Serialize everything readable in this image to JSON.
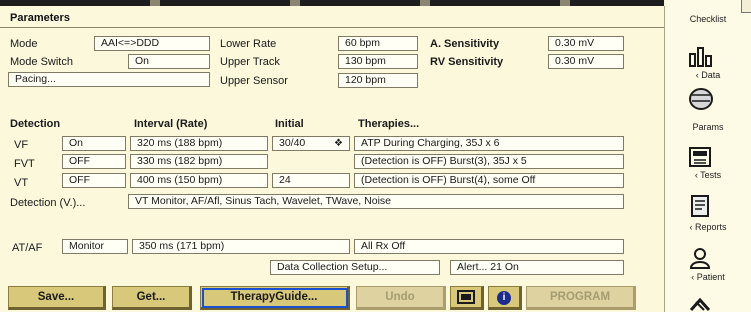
{
  "title": "Parameters",
  "params": {
    "mode_label": "Mode",
    "mode_value": "AAI<=>DDD",
    "mode_switch_label": "Mode Switch",
    "mode_switch_value": "On",
    "pacing_label": "Pacing...",
    "lower_rate_label": "Lower Rate",
    "lower_rate_value": "60 bpm",
    "upper_track_label": "Upper Track",
    "upper_track_value": "130 bpm",
    "upper_sensor_label": "Upper Sensor",
    "upper_sensor_value": "120 bpm",
    "a_sens_label": "A. Sensitivity",
    "a_sens_value": "0.30 mV",
    "rv_sens_label": "RV Sensitivity",
    "rv_sens_value": "0.30 mV"
  },
  "detection": {
    "headers": {
      "detection": "Detection",
      "interval": "Interval (Rate)",
      "initial": "Initial",
      "therapies": "Therapies..."
    },
    "rows": [
      {
        "zone": "VF",
        "status": "On",
        "interval": "320 ms (188 bpm)",
        "initial": "30/40",
        "therapy": "ATP During Charging, 35J x 6"
      },
      {
        "zone": "FVT",
        "status": "OFF",
        "interval": "330 ms (182 bpm)",
        "initial": "",
        "therapy": "(Detection is OFF)    Burst(3), 35J x 5"
      },
      {
        "zone": "VT",
        "status": "OFF",
        "interval": "400 ms (150 bpm)",
        "initial": "24",
        "therapy": "(Detection is OFF)    Burst(4), some Off"
      }
    ],
    "detection_v_label": "Detection (V.)...",
    "detection_v_value": "VT Monitor, AF/Afl, Sinus Tach, Wavelet, TWave, Noise"
  },
  "ataf": {
    "label": "AT/AF",
    "mode": "Monitor",
    "interval": "350 ms (171 bpm)",
    "therapy": "All Rx Off"
  },
  "data_collection": "Data Collection Setup...",
  "alert": "Alert... 21 On",
  "buttons": {
    "save": "Save...",
    "get": "Get...",
    "therapy_guide": "TherapyGuide...",
    "undo": "Undo",
    "info": "i",
    "program": "PROGRAM"
  },
  "sidebar": {
    "checklist": "Checklist",
    "data": "‹ Data",
    "params": "Params",
    "tests": "‹ Tests",
    "reports": "‹ Reports",
    "patient": "‹ Patient"
  }
}
